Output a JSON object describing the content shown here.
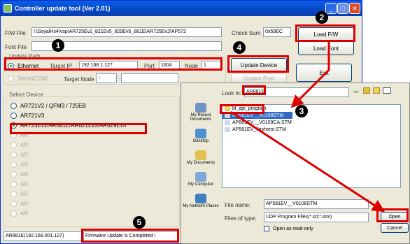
{
  "window": {
    "title": "Controller update tool  (Ver 2.01)"
  },
  "fields": {
    "fw_label": "F/W File",
    "fw_value": "I:\\SoyalHs4\\vsp\\AR725Ev2_821Ev5_829Ev5_881E\\AR725Ev2\\AP572",
    "checksum_label": "Check Sum",
    "checksum_value": "0x59EC",
    "font_label": "Font File"
  },
  "update_path": {
    "title": "Update Path",
    "ethernet": "Ethernet",
    "target_ip_label": "Target IP",
    "target_ip": "192.168.1.127",
    "port_label": "Port",
    "port": "1604",
    "node_label": "Node",
    "node": "1",
    "serial": "Serial(COM)",
    "target_node_label": "Target Node",
    "target_node": "1"
  },
  "buttons": {
    "load_fw": "Load F/W",
    "load_font": "Load Font",
    "update_device": "Update Device",
    "update_font": "Update Font",
    "exit": "Exit"
  },
  "select_device": {
    "title": "Select Device",
    "items": [
      {
        "label": "AR721V2 / QFM3 / 725EB",
        "enabled": true,
        "selected": false
      },
      {
        "label": "AR721V3",
        "enabled": true,
        "selected": false
      },
      {
        "label": "AR725Ev2/AR881E/AR821Ev5/AR829Ev5",
        "enabled": true,
        "selected": true
      },
      {
        "label": "AR",
        "enabled": false,
        "selected": false
      },
      {
        "label": "AR",
        "enabled": false,
        "selected": false
      },
      {
        "label": "AR",
        "enabled": false,
        "selected": false
      },
      {
        "label": "AR",
        "enabled": false,
        "selected": false
      },
      {
        "label": "AR",
        "enabled": false,
        "selected": false
      },
      {
        "label": "AR",
        "enabled": false,
        "selected": false
      },
      {
        "label": "AR",
        "enabled": false,
        "selected": false
      },
      {
        "label": "AR",
        "enabled": false,
        "selected": false
      },
      {
        "label": "AR",
        "enabled": false,
        "selected": false
      }
    ]
  },
  "status": {
    "device": "AR881E(192.168.001.127)",
    "message": "Firmware Update is Completed !"
  },
  "dialog": {
    "look_in_label": "Look in:",
    "look_in_value": "AR881E",
    "sidebar": [
      "My Recent Documents",
      "Desktop",
      "My Documents",
      "My Computer",
      "My Network Places"
    ],
    "files": [
      "bl_api_program",
      "AP581EV__V0108STM",
      "AP881EV__V0109CA.STM",
      "AP581EV_flashtest.STM"
    ],
    "file_name_label": "File name:",
    "file_name_value": "AP581EV__V0108STM",
    "files_of_type_label": "Files of type:",
    "files_of_type_value": "UDP Program Files(*.stl;*.stm)",
    "read_only_label": "Open as read-only",
    "open": "Open",
    "cancel": "Cancel"
  },
  "markers": [
    "1",
    "2",
    "3",
    "4",
    "5"
  ],
  "colors": {
    "highlight": "#dd0000",
    "titlebar": "#0747c5",
    "window_bg": "#ece9d8"
  }
}
